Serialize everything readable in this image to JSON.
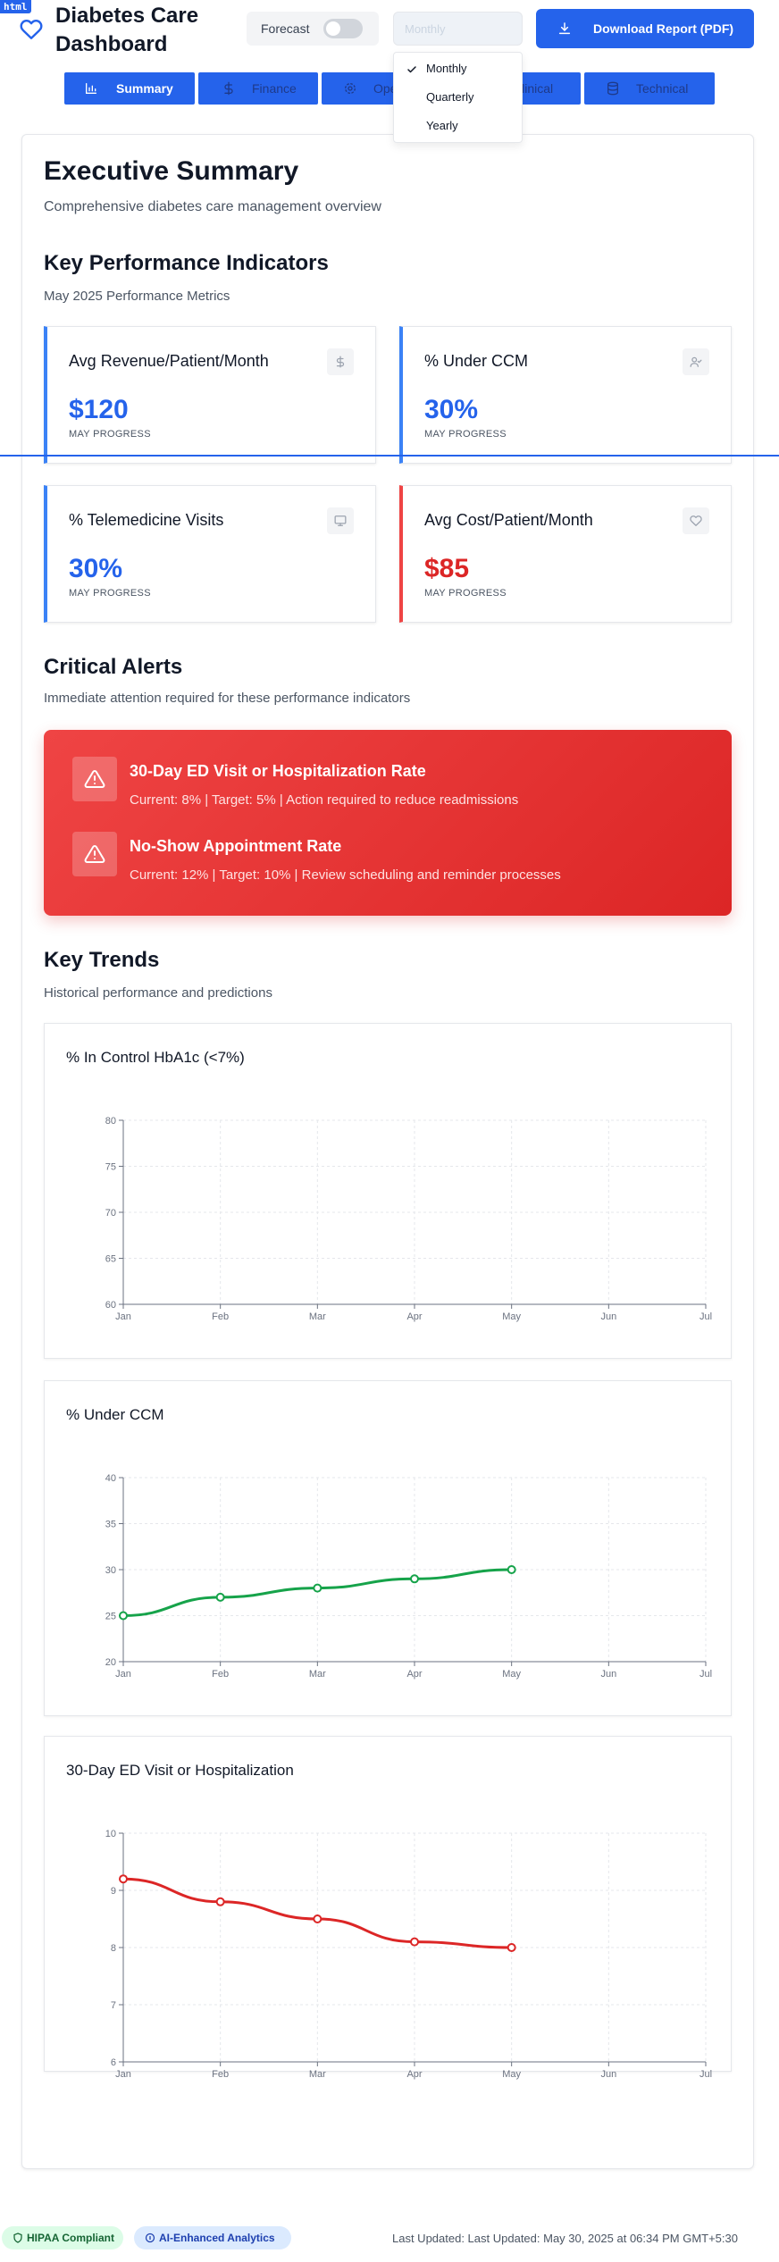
{
  "devtools_label": "html",
  "header": {
    "title": "Diabetes Care Dashboard",
    "forecast_label": "Forecast",
    "forecast_on": false,
    "period_selected": "Monthly",
    "download_label": "Download Report (PDF)"
  },
  "dropdown": {
    "options": [
      "Monthly",
      "Quarterly",
      "Yearly"
    ],
    "selected": "Monthly"
  },
  "tabs": [
    {
      "label": "Summary",
      "icon": "bar-chart-icon",
      "active": true
    },
    {
      "label": "Finance",
      "icon": "dollar-icon",
      "active": false
    },
    {
      "label": "Operations",
      "icon": "gear-icon",
      "active": false
    },
    {
      "label": "Clinical",
      "icon": "clinical-icon",
      "active": false
    },
    {
      "label": "Technical",
      "icon": "database-icon",
      "active": false
    }
  ],
  "summary": {
    "title": "Executive Summary",
    "subtitle": "Comprehensive diabetes care management overview"
  },
  "kpi_section": {
    "title": "Key Performance Indicators",
    "subtitle": "May 2025 Performance Metrics"
  },
  "kpis": [
    {
      "title": "Avg Revenue/Patient/Month",
      "value": "$120",
      "sub": "MAY PROGRESS",
      "icon": "dollar-icon",
      "accent": "#3b82f6"
    },
    {
      "title": "% Under CCM",
      "value": "30%",
      "sub": "MAY PROGRESS",
      "icon": "user-check-icon",
      "accent": "#3b82f6"
    },
    {
      "title": "% Telemedicine Visits",
      "value": "30%",
      "sub": "MAY PROGRESS",
      "icon": "monitor-icon",
      "accent": "#3b82f6"
    },
    {
      "title": "Avg Cost/Patient/Month",
      "value": "$85",
      "sub": "MAY PROGRESS",
      "icon": "heart-icon",
      "accent": "#ef4444"
    }
  ],
  "alerts_section": {
    "title": "Critical Alerts",
    "subtitle": "Immediate attention required for these performance indicators"
  },
  "alerts": [
    {
      "title": "30-Day ED Visit or Hospitalization Rate",
      "desc": "Current: 8% | Target: 5% | Action required to reduce readmissions"
    },
    {
      "title": "No-Show Appointment Rate",
      "desc": "Current: 12% | Target: 10% | Review scheduling and reminder processes"
    }
  ],
  "trends_section": {
    "title": "Key Trends",
    "subtitle": "Historical performance and predictions"
  },
  "chart_data": [
    {
      "type": "line",
      "title": "% In Control HbA1c (<7%)",
      "x": [
        "Jan",
        "Feb",
        "Mar",
        "Apr",
        "May",
        "Jun",
        "Jul"
      ],
      "ylim": [
        60,
        80
      ],
      "yticks": [
        60,
        65,
        70,
        75,
        80
      ],
      "series": [],
      "grid": true
    },
    {
      "type": "line",
      "title": "% Under CCM",
      "x": [
        "Jan",
        "Feb",
        "Mar",
        "Apr",
        "May",
        "Jun",
        "Jul"
      ],
      "ylim": [
        20,
        40
      ],
      "yticks": [
        20,
        25,
        30,
        35,
        40
      ],
      "series": [
        {
          "color": "#16a34a",
          "values": [
            25,
            27,
            28,
            29,
            30
          ]
        }
      ],
      "grid": true
    },
    {
      "type": "line",
      "title": "30-Day ED Visit or Hospitalization",
      "x": [
        "Jan",
        "Feb",
        "Mar",
        "Apr",
        "May",
        "Jun",
        "Jul"
      ],
      "ylim": [
        6,
        10
      ],
      "yticks": [
        6,
        7,
        8,
        9,
        10
      ],
      "series": [
        {
          "color": "#dc2626",
          "values": [
            9.2,
            8.8,
            8.5,
            8.1,
            8.0
          ]
        }
      ],
      "grid": true
    }
  ],
  "footer": {
    "hipaa": "HIPAA Compliant",
    "ai": "AI-Enhanced Analytics",
    "updated": "Last Updated: Last Updated: May 30, 2025 at 06:34 PM GMT+5:30"
  },
  "colors": {
    "primary": "#2563eb",
    "alert": "#dc2626",
    "success": "#16a34a"
  }
}
